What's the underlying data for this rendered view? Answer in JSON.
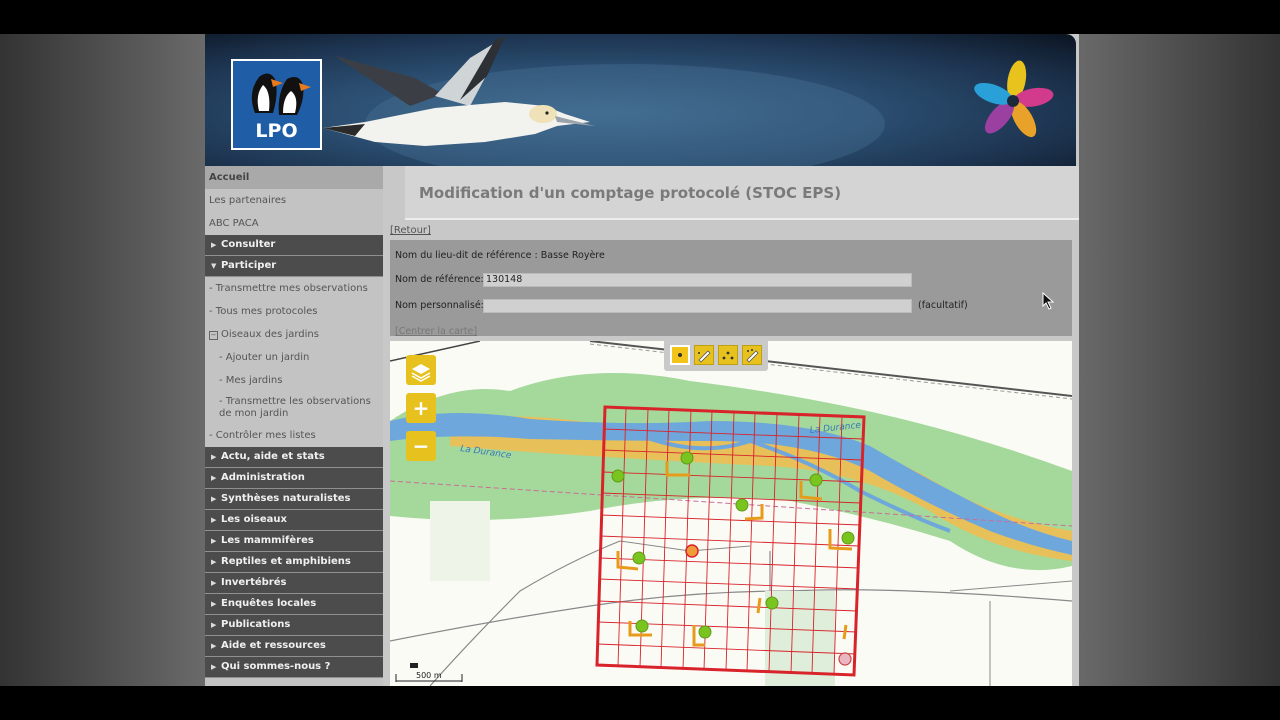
{
  "banner": {
    "logo_text": "LPO"
  },
  "sidebar": {
    "top_links": [
      "Accueil",
      "Les partenaires",
      "ABC PACA"
    ],
    "consulter": "Consulter",
    "participer": "Participer",
    "participer_items": [
      "- Transmettre mes observations",
      "- Tous mes protocoles"
    ],
    "jardins": "Oiseaux des jardins",
    "jardins_items": [
      "- Ajouter un jardin",
      "- Mes jardins",
      "- Transmettre les observations de mon jardin"
    ],
    "controler": "- Contrôler mes listes",
    "sections": [
      "Actu, aide et stats",
      "Administration",
      "Synthèses naturalistes",
      "Les oiseaux",
      "Les mammifères",
      "Reptiles et amphibiens",
      "Invertébrés",
      "Enquêtes locales",
      "Publications",
      "Aide et ressources",
      "Qui sommes-nous ?"
    ]
  },
  "main": {
    "title": "Modification d'un comptage protocolé (STOC EPS)",
    "retour": "[Retour]",
    "lieu_dit_label": "Nom du lieu-dit de référence : Basse Royère",
    "ref_label": "Nom de référence:",
    "ref_value": "130148",
    "perso_label": "Nom personnalisé:",
    "perso_value": "",
    "facultatif": "(facultatif)",
    "centrer": "[Centrer la carte]"
  },
  "map": {
    "river_label_1": "La Durance",
    "river_label_2": "La Durance",
    "scale_label": "500 m",
    "zoom_in": "+",
    "zoom_out": "−",
    "layers_icon": "layers-icon",
    "draw_tools": [
      "point-tool-icon",
      "draw-line-tool-icon",
      "multipoint-tool-icon",
      "edit-tool-icon"
    ],
    "colors": {
      "grid": "#d8232a",
      "point_green": "#7ac41f",
      "marker_orange": "#e89b1a",
      "river": "#6ea7dc",
      "sand": "#e8c05a",
      "forest": "#a4d99b"
    }
  }
}
